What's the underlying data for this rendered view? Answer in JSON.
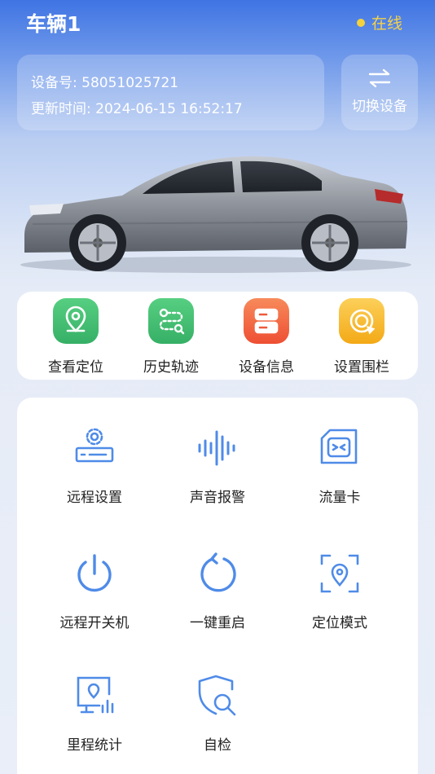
{
  "header": {
    "title": "车辆1",
    "status": "在线",
    "status_color": "#f3d23e"
  },
  "device": {
    "id_text": "设备号: 58051025721",
    "update_text": "更新时间: 2024-06-15 16:52:17"
  },
  "switch_button": {
    "label": "切换设备",
    "icon": "switch-arrows-icon"
  },
  "quick_actions": [
    {
      "label": "查看定位",
      "icon": "location-pin-icon",
      "color": "#3dbb6c"
    },
    {
      "label": "历史轨迹",
      "icon": "track-route-icon",
      "color": "#3dbb6c"
    },
    {
      "label": "设备信息",
      "icon": "device-info-icon",
      "color": "#f0603c"
    },
    {
      "label": "设置围栏",
      "icon": "fence-icon",
      "color": "#f5b91f"
    }
  ],
  "functions": [
    {
      "label": "远程设置",
      "icon": "remote-settings-icon"
    },
    {
      "label": "声音报警",
      "icon": "sound-alarm-icon"
    },
    {
      "label": "流量卡",
      "icon": "sim-card-icon"
    },
    {
      "label": "远程开关机",
      "icon": "power-icon"
    },
    {
      "label": "一键重启",
      "icon": "restart-icon"
    },
    {
      "label": "定位模式",
      "icon": "location-mode-icon"
    },
    {
      "label": "里程统计",
      "icon": "mileage-stats-icon"
    },
    {
      "label": "自检",
      "icon": "self-check-icon"
    }
  ],
  "colors": {
    "icon_blue": "#4f8be8"
  }
}
